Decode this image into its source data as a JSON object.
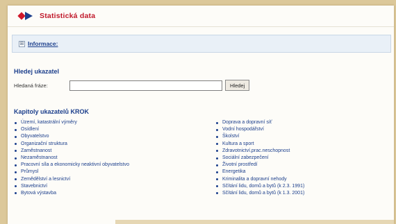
{
  "header": {
    "title": "Statistická data"
  },
  "info": {
    "toggle": "⊞",
    "label": "Informace:"
  },
  "search": {
    "heading": "Hledej ukazatel",
    "label": "Hledaná fráze:",
    "value": "",
    "button": "Hledej"
  },
  "chapters": {
    "heading": "Kapitoly ukazatelů KROK",
    "left": [
      "Území, katastrální výměry",
      "Osídlení",
      "Obyvatelstvo",
      "Organizační struktura",
      "Zaměstnanost",
      "Nezaměstnanost",
      "Pracovní síla a ekonomicky neaktivní obyvatelstvo",
      "Průmysl",
      "Zemědělství a lesnictví",
      "Stavebnictví",
      "Bytová výstavba"
    ],
    "right": [
      "Doprava a dopravní síť",
      "Vodní hospodářství",
      "Školství",
      "Kultura a sport",
      "Zdravotnictví,prac.neschopnost",
      "Sociální zabezpečení",
      "Životní prostředí",
      "Energetika",
      "Kriminalita a dopravní nehody",
      "Sčítání lidu, domů a bytů (k 2.3. 1991)",
      "Sčítání lidu, domů a bytů (k 1.3. 2001)"
    ]
  }
}
